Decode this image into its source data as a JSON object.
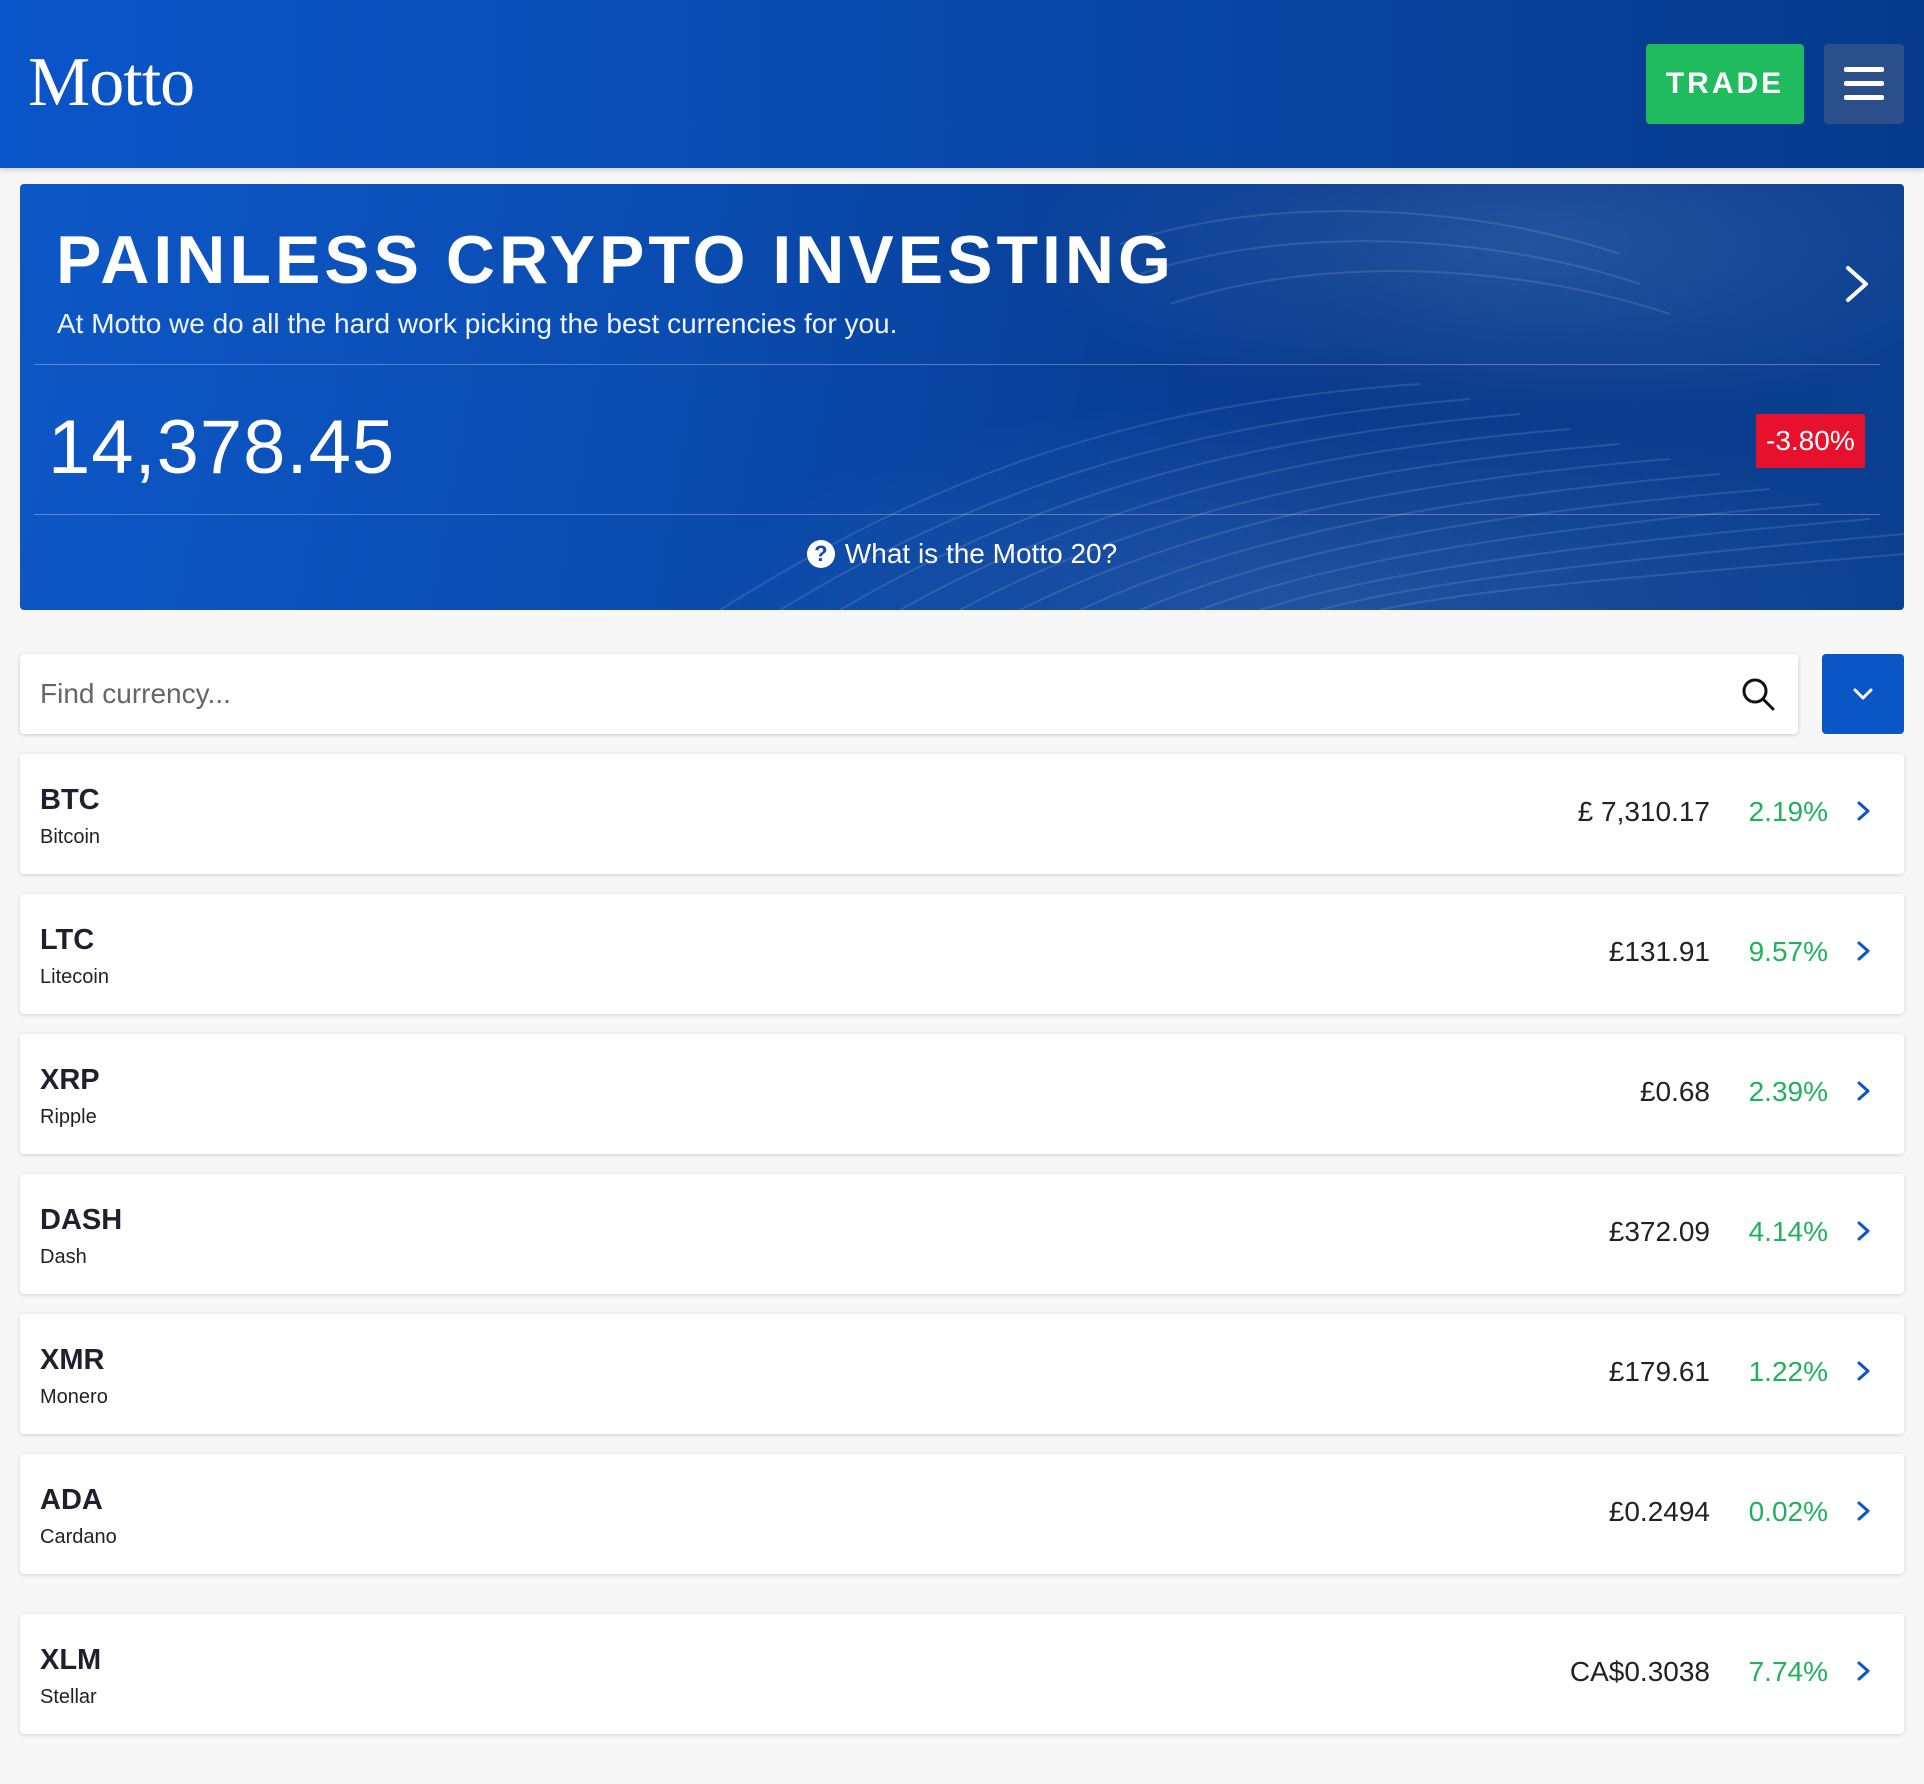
{
  "header": {
    "logo": "Motto",
    "trade_label": "TRADE",
    "menu_icon": "hamburger-icon"
  },
  "hero": {
    "title": "PAINLESS CRYPTO INVESTING",
    "subtitle": "At Motto we do all the hard work picking the best currencies for you.",
    "index_value": "14,378.45",
    "index_change": "-3.80%",
    "info_link": "What is the Motto 20?",
    "next_icon": "chevron-right-icon"
  },
  "search": {
    "placeholder": "Find currency...",
    "value": ""
  },
  "colors": {
    "header_blue": "#0a55c9",
    "trade_green": "#1fbb5e",
    "negative_red": "#e8112d",
    "positive_green": "#1fb25a",
    "chevron_blue": "#0a56c6"
  },
  "coins": [
    {
      "symbol": "BTC",
      "name": "Bitcoin",
      "price": "£ 7,310.17",
      "change": "2.19%"
    },
    {
      "symbol": "LTC",
      "name": "Litecoin",
      "price": "£131.91",
      "change": "9.57%"
    },
    {
      "symbol": "XRP",
      "name": "Ripple",
      "price": "£0.68",
      "change": "2.39%"
    },
    {
      "symbol": "DASH",
      "name": "Dash",
      "price": "£372.09",
      "change": "4.14%"
    },
    {
      "symbol": "XMR",
      "name": "Monero",
      "price": "£179.61",
      "change": "1.22%"
    },
    {
      "symbol": "ADA",
      "name": "Cardano",
      "price": "£0.2494",
      "change": "0.02%"
    },
    {
      "symbol": "XLM",
      "name": "Stellar",
      "price": "CA$0.3038",
      "change": "7.74%"
    }
  ]
}
